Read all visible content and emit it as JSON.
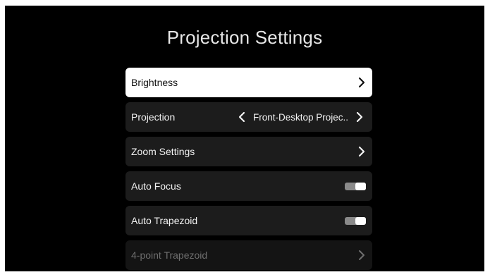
{
  "title": "Projection Settings",
  "menu": {
    "brightness": {
      "label": "Brightness",
      "icon": "chevron-right-icon"
    },
    "projection": {
      "label": "Projection",
      "value": "Front-Desktop Projec..",
      "prev_icon": "chevron-left-icon",
      "next_icon": "chevron-right-icon"
    },
    "zoom": {
      "label": "Zoom Settings",
      "icon": "chevron-right-icon"
    },
    "auto_focus": {
      "label": "Auto Focus",
      "state": "on"
    },
    "auto_trapezoid": {
      "label": "Auto Trapezoid",
      "state": "on"
    },
    "four_point": {
      "label": "4-point Trapezoid",
      "icon": "chevron-right-icon",
      "enabled": false
    }
  },
  "colors": {
    "background": "#000000",
    "row": "#1c1c1c",
    "row_focused": "#ffffff",
    "text": "#f2f2f2",
    "text_disabled": "#6f6f6f",
    "toggle_track": "#8a8a8a",
    "toggle_knob": "#ffffff"
  }
}
